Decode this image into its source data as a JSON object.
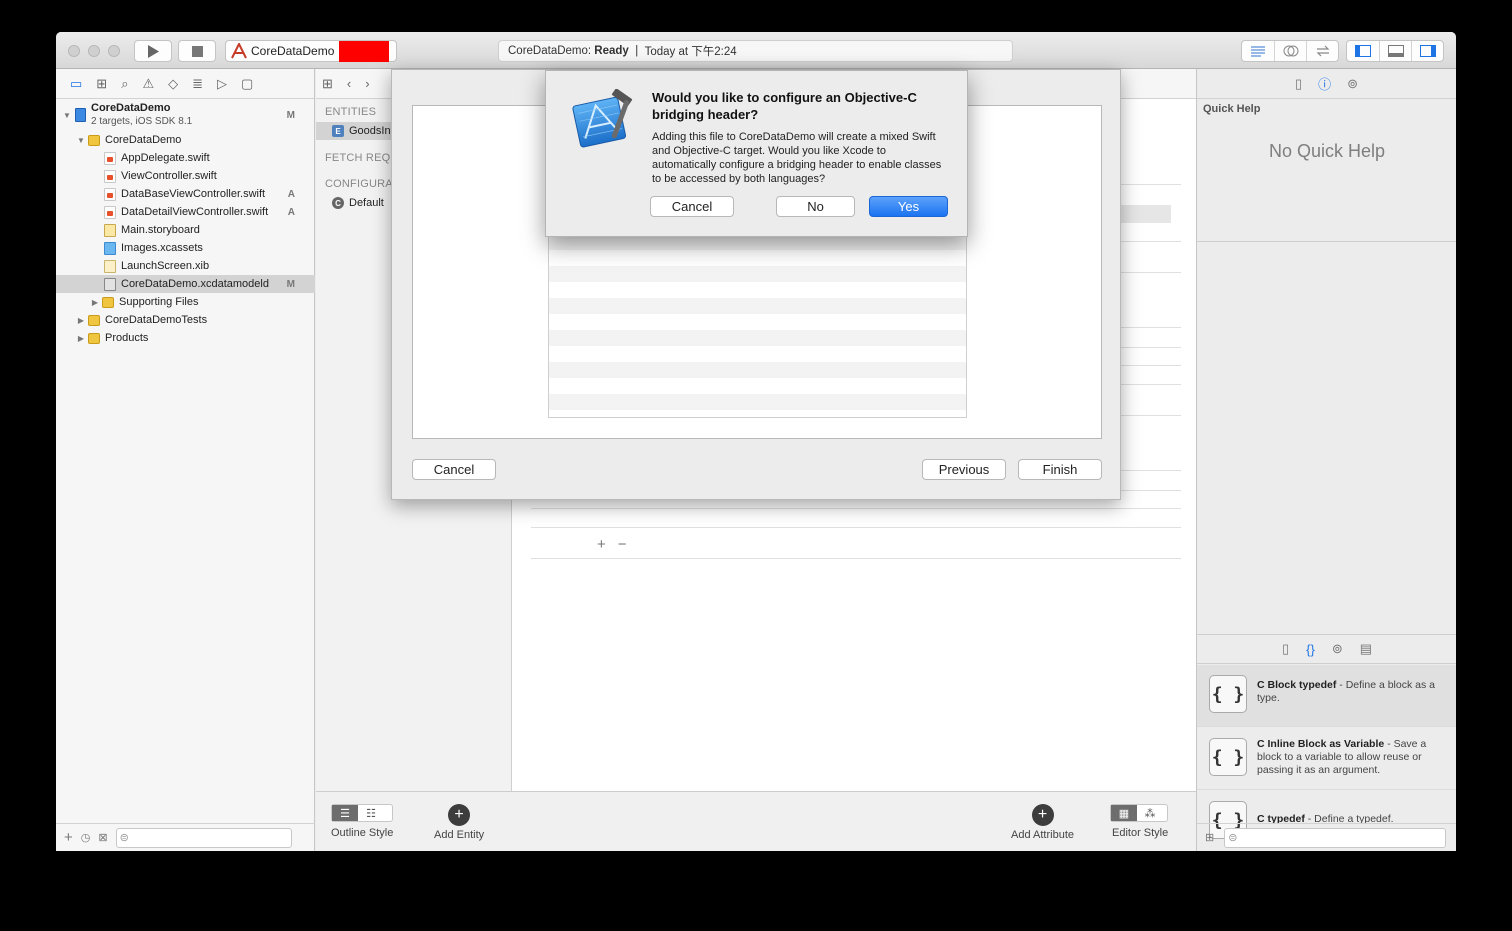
{
  "toolbar": {
    "scheme": "CoreDataDemo",
    "activity_project": "CoreDataDemo:",
    "activity_status": "Ready",
    "activity_separator": "|",
    "activity_time": "Today at 下午2:24"
  },
  "navigator": {
    "project": {
      "name": "CoreDataDemo",
      "subtitle": "2 targets, iOS SDK 8.1",
      "badge": "M"
    },
    "items": [
      {
        "label": "CoreDataDemo",
        "badge": ""
      },
      {
        "label": "AppDelegate.swift",
        "badge": ""
      },
      {
        "label": "ViewController.swift",
        "badge": ""
      },
      {
        "label": "DataBaseViewController.swift",
        "badge": "A"
      },
      {
        "label": "DataDetailViewController.swift",
        "badge": "A"
      },
      {
        "label": "Main.storyboard",
        "badge": ""
      },
      {
        "label": "Images.xcassets",
        "badge": ""
      },
      {
        "label": "LaunchScreen.xib",
        "badge": ""
      },
      {
        "label": "CoreDataDemo.xcdatamodeld",
        "badge": "M"
      },
      {
        "label": "Supporting Files",
        "badge": ""
      },
      {
        "label": "CoreDataDemoTests",
        "badge": ""
      },
      {
        "label": "Products",
        "badge": ""
      }
    ]
  },
  "outline": {
    "entities_header": "ENTITIES",
    "entity": "GoodsIn",
    "entity_icon": "E",
    "fetch_header": "FETCH REQ",
    "config_header": "CONFIGURA",
    "config_item": "Default",
    "config_icon": "C"
  },
  "editor_bottom": {
    "outline_style": "Outline Style",
    "add_entity": "Add Entity",
    "add_attribute": "Add Attribute",
    "editor_style": "Editor Style"
  },
  "sheet": {
    "cancel": "Cancel",
    "previous": "Previous",
    "finish": "Finish"
  },
  "alert": {
    "title": "Would you like to configure an Objective-C bridging header?",
    "message": "Adding this file to CoreDataDemo will create a mixed Swift and Objective-C target. Would you like Xcode to automatically configure a bridging header to enable classes to be accessed by both languages?",
    "cancel": "Cancel",
    "no": "No",
    "yes": "Yes",
    "icon": "xcode-hammer-icon"
  },
  "inspector": {
    "quick_help_title": "Quick Help",
    "no_quick_help": "No Quick Help",
    "snippets": [
      {
        "title": "C Block typedef",
        "desc": " - Define a block as a type."
      },
      {
        "title": "C Inline Block as Variable",
        "desc": " - Save a block to a variable to allow reuse or passing it as an argument."
      },
      {
        "title": "C typedef",
        "desc": " - Define a typedef."
      }
    ]
  },
  "colors": {
    "accent": "#1e74e5",
    "default_button": "#1a73f0",
    "redaction": "#ff0000"
  }
}
